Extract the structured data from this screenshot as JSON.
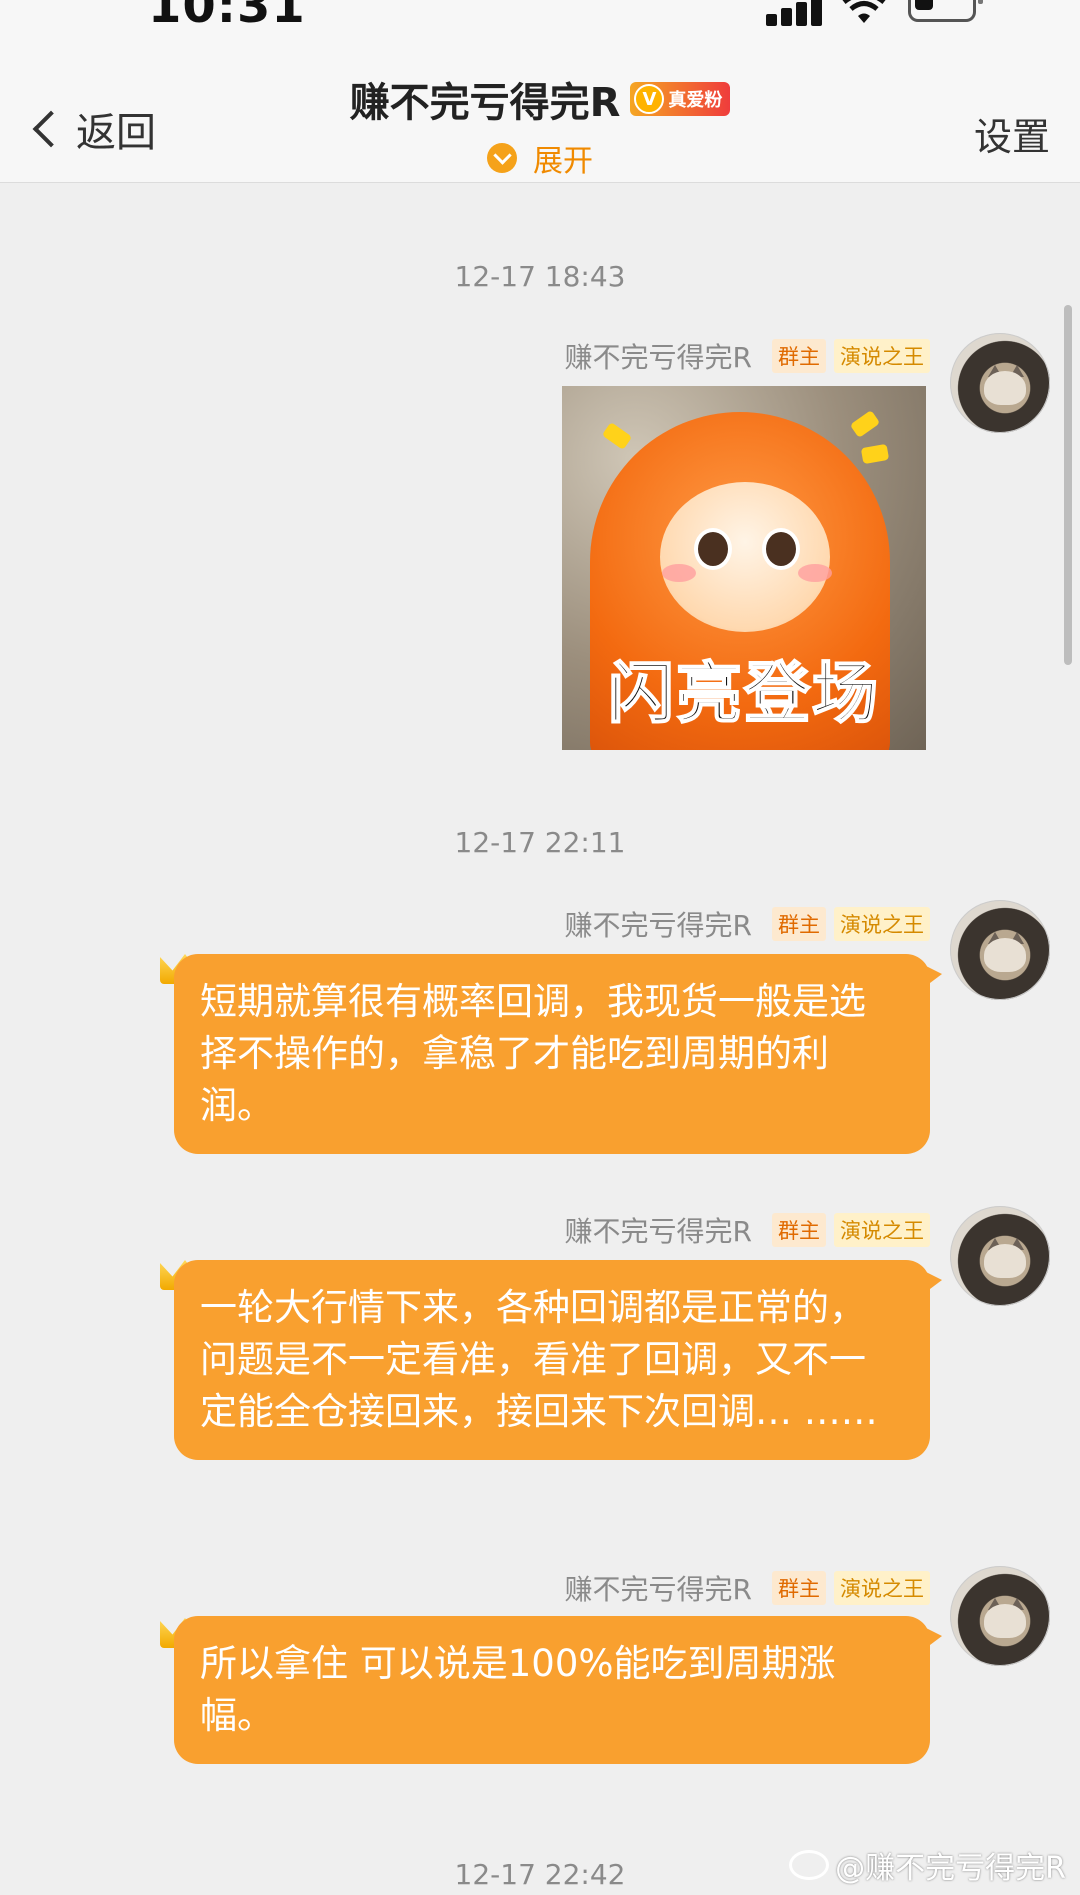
{
  "status_bar": {
    "time": "10:31"
  },
  "nav": {
    "back_label": "返回",
    "title": "赚不完亏得完R",
    "fan_badge": "真爱粉",
    "fan_badge_icon": "V",
    "expand_label": "展开",
    "settings_label": "设置"
  },
  "timestamps": [
    "12-17 18:43",
    "12-17 22:11",
    "12-17 22:42"
  ],
  "sender": {
    "name": "赚不完亏得完R",
    "tags": [
      "群主",
      "演说之王"
    ]
  },
  "messages": [
    {
      "type": "sticker",
      "caption": "闪亮登场"
    },
    {
      "type": "text",
      "text": "短期就算很有概率回调，我现货一般是选择不操作的，拿稳了才能吃到周期的利润。"
    },
    {
      "type": "text",
      "text": "一轮大行情下来，各种回调都是正常的，问题是不一定看准，看准了回调，又不一定能全仓接回来，接回来下次回调… ……"
    },
    {
      "type": "text",
      "text": "所以拿住 可以说是100%能吃到周期涨幅。"
    }
  ],
  "watermark": "@赚不完亏得完R",
  "colors": {
    "bubble": "#f9a02f",
    "accent": "#f08a00",
    "background": "#efefef"
  }
}
